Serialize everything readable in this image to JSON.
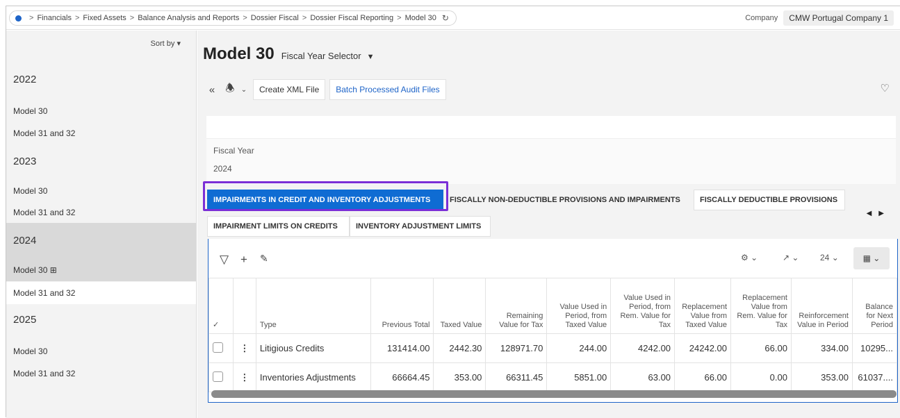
{
  "breadcrumb": {
    "items": [
      "Financials",
      "Fixed Assets",
      "Balance Analysis and Reports",
      "Dossier Fiscal",
      "Dossier Fiscal Reporting",
      "Model 30"
    ],
    "separator": ">"
  },
  "company": {
    "label": "Company",
    "value": "CMW Portugal Company 1"
  },
  "sidebar": {
    "sort_label": "Sort by",
    "groups": [
      {
        "year": "2022",
        "items": [
          "Model 30",
          "Model 31 and 32"
        ]
      },
      {
        "year": "2023",
        "items": [
          "Model 30",
          "Model 31 and 32"
        ]
      },
      {
        "year": "2024",
        "items": [
          "Model 30",
          "Model 31 and 32"
        ]
      },
      {
        "year": "2025",
        "items": [
          "Model 30",
          "Model 31 and 32"
        ]
      }
    ]
  },
  "page": {
    "title": "Model 30",
    "selector": "Fiscal Year Selector"
  },
  "toolbar": {
    "create_xml": "Create XML File",
    "batch_audit": "Batch Processed Audit Files"
  },
  "fiscal": {
    "label": "Fiscal Year",
    "value": "2024"
  },
  "tabs": [
    "IMPAIRMENTS IN CREDIT AND INVENTORY ADJUSTMENTS",
    "FISCALLY NON-DEDUCTIBLE PROVISIONS AND IMPAIRMENTS",
    "FISCALLY DEDUCTIBLE PROVISIONS",
    "IMPAIRMENT LIMITS ON CREDITS",
    "INVENTORY ADJUSTMENT LIMITS"
  ],
  "grid": {
    "page_size": "24",
    "columns": [
      "Type",
      "Previous Total",
      "Taxed Value",
      "Remaining Value for Tax",
      "Value Used in Period, from Taxed Value",
      "Value Used in Period, from Rem. Value for Tax",
      "Replacement Value from Taxed Value",
      "Replacement Value from Rem. Value for Tax",
      "Reinforcement Value in Period",
      "Balance for Next Period"
    ],
    "rows": [
      [
        "Litigious Credits",
        "131414.00",
        "2442.30",
        "128971.70",
        "244.00",
        "4242.00",
        "24242.00",
        "66.00",
        "334.00",
        "10295..."
      ],
      [
        "Inventories Adjustments",
        "66664.45",
        "353.00",
        "66311.45",
        "5851.00",
        "63.00",
        "66.00",
        "0.00",
        "353.00",
        "61037...."
      ]
    ]
  }
}
